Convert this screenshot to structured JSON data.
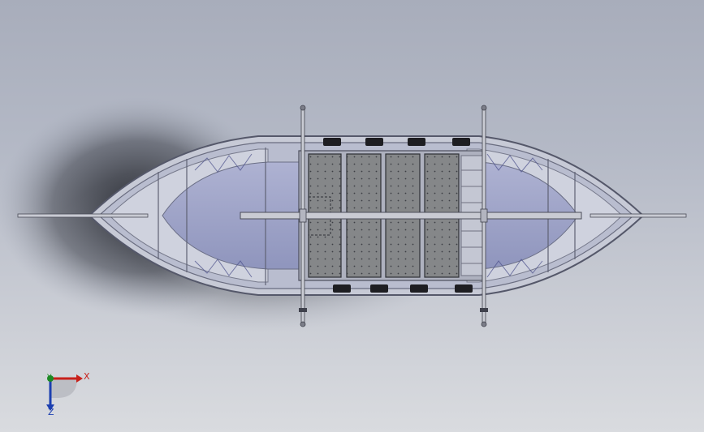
{
  "viewport": {
    "background_top": "#a8adbb",
    "background_bottom": "#d9dbdf",
    "model": "boat-assembly-top-view"
  },
  "triad": {
    "x_label": "X",
    "y_label": "Y",
    "z_label": "Z",
    "x_color": "#c8201a",
    "y_color": "#1d8a25",
    "z_color": "#1c3fb0"
  },
  "colors": {
    "hull_outline": "#5f6270",
    "hull_floor": "#9da3c7",
    "deck_panel": "#7f8185",
    "oar": "#c9cbd3",
    "oarlock": "#1e1e22"
  }
}
